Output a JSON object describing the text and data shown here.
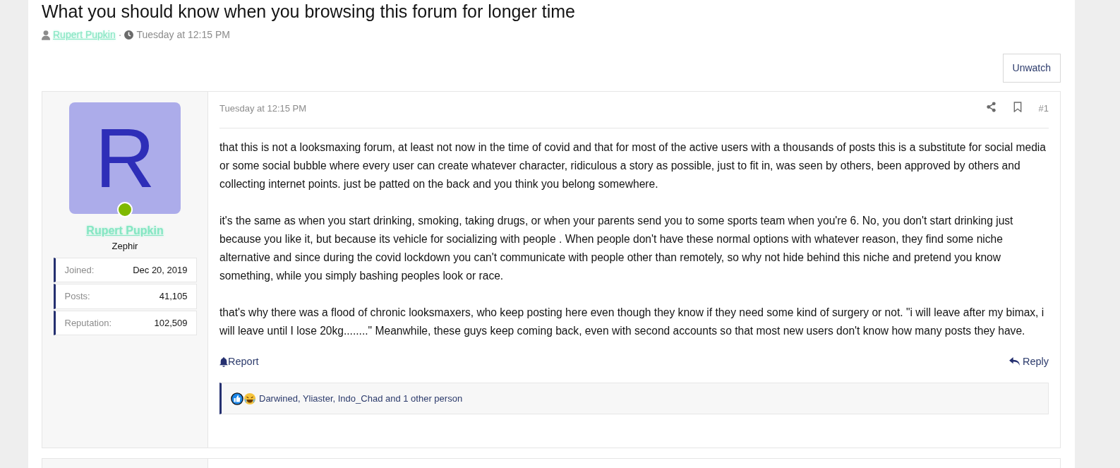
{
  "thread": {
    "title": "What you should know when you browsing this forum for longer time",
    "author": "Rupert Pupkin",
    "separator": "·",
    "date": "Tuesday at 12:15 PM"
  },
  "watch_button": "Unwatch",
  "post": {
    "user": {
      "avatar_letter": "R",
      "online": true,
      "name": "Rupert Pupkin",
      "title": "Zephir",
      "stats": [
        {
          "label": "Joined:",
          "value": "Dec 20, 2019"
        },
        {
          "label": "Posts:",
          "value": "41,105"
        },
        {
          "label": "Reputation:",
          "value": "102,509"
        }
      ]
    },
    "date": "Tuesday at 12:15 PM",
    "number": "#1",
    "paragraphs": [
      "that this is not a looksmaxing forum, at least not now in the time of covid and that for most of the active users with a thousands of posts this is a substitute for social media or some social bubble where every user can create whatever character, ridiculous a story as possible, just to fit in, was seen by others, been approved by others and collecting internet points. just be patted on the back and you think you belong somewhere.",
      "it's the same as when you start drinking, smoking, taking drugs, or when your parents send you to some sports team when you're 6. No, you don't start drinking just because you like it, but because its vehicle for socializing with people . When people don't have these normal options with whatever reason, they find some niche alternative and since during the covid lockdown you can't communicate with people other than remotely, so why not hide behind this niche and pretend you know something, while you simply bashing peoples look or race.",
      "that's why there was a flood of chronic looksmaxers, who keep posting here even though they know if they need some kind of surgery or not. \"i will leave after my bimax, i will leave until I lose 20kg........\" Meanwhile, these guys keep coming back, even with second accounts so that most new users don't know how many posts they have."
    ],
    "report": "Report",
    "reply": "Reply",
    "reactions": "Darwined, Yliaster, Indo_Chad and 1 other person"
  }
}
